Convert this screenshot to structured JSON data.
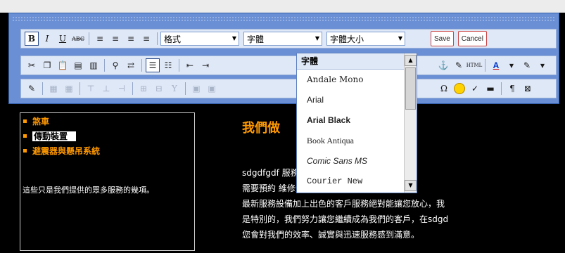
{
  "toolbar": {
    "bold": "B",
    "italic": "I",
    "underline": "U",
    "strike": "ABC",
    "format_select": "格式",
    "font_select": "字體",
    "size_select": "字體大小",
    "save_label": "Save",
    "cancel_label": "Cancel",
    "font_color_label": "A",
    "special_char": "Ω"
  },
  "font_dropdown": {
    "title": "字體",
    "options": [
      "Andale Mono",
      "Arial",
      "Arial Black",
      "Book Antiqua",
      "Comic Sans MS",
      "Courier New"
    ]
  },
  "sidebar": {
    "items": [
      {
        "label": "煞車"
      },
      {
        "label": "傳動裝置"
      },
      {
        "label": "避震器與懸吊系統"
      }
    ],
    "note": "這些只是我們提供的眾多服務的幾項。"
  },
  "main": {
    "heading": "我們做",
    "paragraph_lines": [
      "sdgdfgdf                              服務，我們可維修各式各樣",
      "需要預約                              維修受損或故障的部分，",
      "最新服務設備加上出色的客戶服務絕對能讓您放心，我",
      "是特別的，我們努力讓您繼續成為我們的客戶，在sdgd",
      "您會對我們的效率、誠實與迅速服務感到滿意。"
    ]
  },
  "colors": {
    "accent": "#ff9900",
    "editor_frame": "#6a8fd4",
    "toolbar_bg": "#dfe8f7",
    "button_border": "#cc4444"
  }
}
